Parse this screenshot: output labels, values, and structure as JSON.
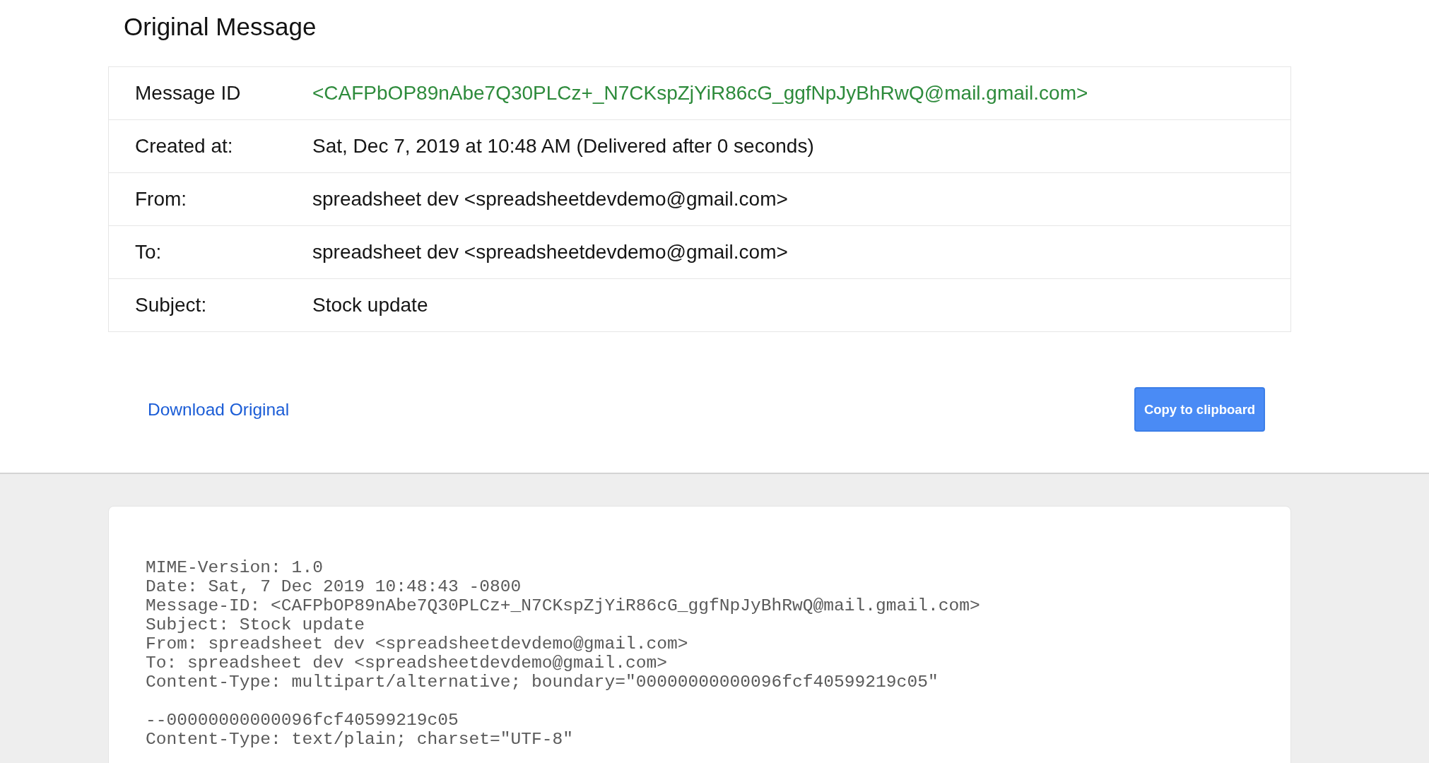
{
  "title": "Original Message",
  "details": [
    {
      "label": "Message ID",
      "value": "<CAFPbOP89nAbe7Q30PLCz+_N7CKspZjYiR86cG_ggfNpJyBhRwQ@mail.gmail.com>",
      "kind": "highlight"
    },
    {
      "label": "Created at:",
      "value": "Sat, Dec 7, 2019 at 10:48 AM (Delivered after 0 seconds)",
      "kind": "plain"
    },
    {
      "label": "From:",
      "value": "spreadsheet dev <spreadsheetdevdemo@gmail.com>",
      "kind": "plain"
    },
    {
      "label": "To:",
      "value": "spreadsheet dev <spreadsheetdevdemo@gmail.com>",
      "kind": "plain"
    },
    {
      "label": "Subject:",
      "value": "Stock update",
      "kind": "plain"
    }
  ],
  "actions": {
    "download_link": "Download Original",
    "copy_button": "Copy to clipboard"
  },
  "raw_source": {
    "blocks": [
      {
        "lines": [
          "MIME-Version: 1.0",
          "Date: Sat, 7 Dec 2019 10:48:43 -0800",
          "Message-ID: <CAFPbOP89nAbe7Q30PLCz+_N7CKspZjYiR86cG_ggfNpJyBhRwQ@mail.gmail.com>",
          "Subject: Stock update",
          "From: spreadsheet dev <spreadsheetdevdemo@gmail.com>",
          "To: spreadsheet dev <spreadsheetdevdemo@gmail.com>",
          "Content-Type: multipart/alternative; boundary=\"00000000000096fcf40599219c05\""
        ]
      },
      {
        "lines": [
          "--00000000000096fcf40599219c05",
          "Content-Type: text/plain; charset=\"UTF-8\""
        ]
      }
    ]
  }
}
